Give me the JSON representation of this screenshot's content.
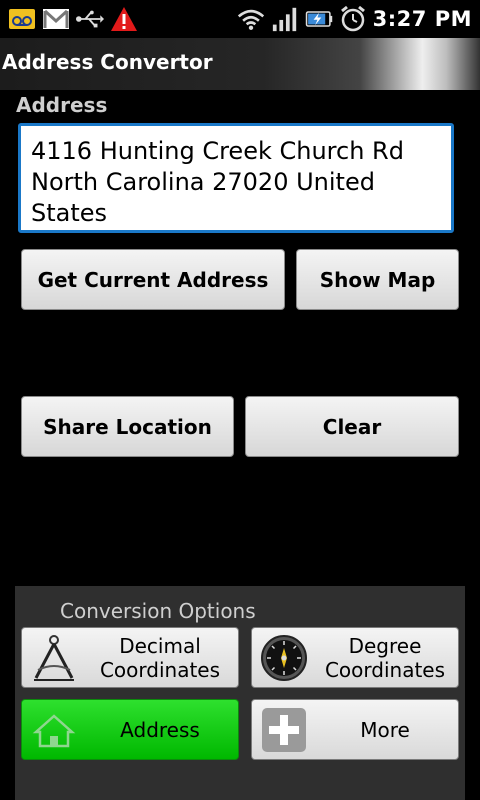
{
  "status_bar": {
    "time": "3:27 PM",
    "left_icons": [
      "voicemail-icon",
      "gmail-icon",
      "usb-icon",
      "warning-icon"
    ],
    "right_icons": [
      "wifi-icon",
      "signal-icon",
      "battery-charging-icon",
      "alarm-icon"
    ]
  },
  "app": {
    "title": "Address Convertor"
  },
  "address_section": {
    "label": "Address",
    "value": "4116 Hunting Creek Church Rd\nNorth Carolina 27020 United\nStates"
  },
  "buttons": {
    "get_current_address": "Get Current Address",
    "show_map": "Show Map",
    "share_location": "Share Location",
    "clear": "Clear"
  },
  "conversion": {
    "title": "Conversion Options",
    "options": [
      {
        "line1": "Decimal",
        "line2": "Coordinates",
        "icon": "compass-divider-icon"
      },
      {
        "line1": "Degree",
        "line2": "Coordinates",
        "icon": "gauge-icon"
      },
      {
        "line1": "Address",
        "line2": "",
        "icon": "home-icon",
        "selected": true
      },
      {
        "line1": "More",
        "line2": "",
        "icon": "plus-icon"
      }
    ]
  },
  "colors": {
    "accent_blue": "#1a78c8",
    "selected_green": "#00c800"
  }
}
